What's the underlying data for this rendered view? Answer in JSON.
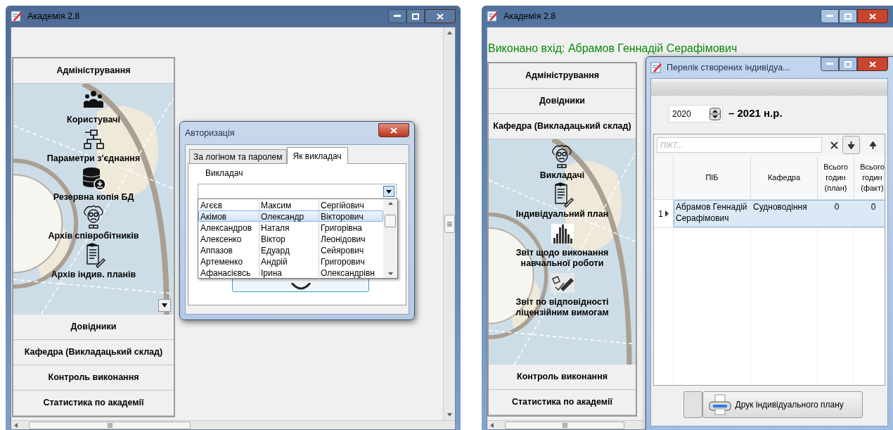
{
  "left_window": {
    "title": "Академія 2.8",
    "nav": [
      {
        "label": "Адміністрування",
        "items": [
          {
            "label": "Користувачі",
            "kind": "users"
          },
          {
            "label": "Параметри з'єднання",
            "kind": "network"
          },
          {
            "label": "Резервна копія БД",
            "kind": "database"
          },
          {
            "label": "Архів співробітників",
            "kind": "professor"
          },
          {
            "label": "Архів індив. планів",
            "kind": "document"
          }
        ]
      },
      {
        "label": "Довідники"
      },
      {
        "label": "Кафедра (Викладацький склад)"
      },
      {
        "label": "Контроль виконання"
      },
      {
        "label": "Статистика по академії"
      }
    ]
  },
  "auth_dialog": {
    "title": "Авторизація",
    "tabs": [
      {
        "label": "За логіном та паролем",
        "selected": false
      },
      {
        "label": "Як викладач",
        "selected": true
      }
    ],
    "field_label": "Викладач",
    "rows": [
      {
        "cells": [
          "Агєєв",
          "Максим",
          "Сергійович"
        ],
        "selected": false
      },
      {
        "cells": [
          "Акімов",
          "Олександр",
          "Вікторович"
        ],
        "selected": true
      },
      {
        "cells": [
          "Александров",
          "Наталя",
          "Григорівна"
        ],
        "selected": false
      },
      {
        "cells": [
          "Алексенко",
          "Віктор",
          "Леонідович"
        ],
        "selected": false
      },
      {
        "cells": [
          "Аппазов",
          "Едуард",
          "Сейярович"
        ],
        "selected": false
      },
      {
        "cells": [
          "Артеменко",
          "Андрій",
          "Григорович"
        ],
        "selected": false
      },
      {
        "cells": [
          "Афанасієвсь",
          "Ірина",
          "Олександрівн"
        ],
        "selected": false
      }
    ]
  },
  "right_window": {
    "title": "Академія 2.8",
    "status": "Виконано вхід: Абрамов Геннадій Серафімович",
    "nav": [
      {
        "label": "Адміністрування"
      },
      {
        "label": "Довідники"
      },
      {
        "label": "Кафедра (Викладацький склад)",
        "items": [
          {
            "label": "Викладачі",
            "kind": "professor"
          },
          {
            "label": "Індивідуальний план",
            "kind": "document"
          },
          {
            "label": "Звіт щодо виконання навчальної роботи",
            "kind": "chart"
          },
          {
            "label": "Звіт по відповідності ліцензійним вимогам",
            "kind": "pencil"
          }
        ]
      },
      {
        "label": "Контроль виконання"
      },
      {
        "label": "Статистика по академії"
      }
    ]
  },
  "plans_window": {
    "title": "Перелік створених індивідуа...",
    "year": "2020",
    "year_suffix": "– 2021 н.р.",
    "search": {
      "placeholder": "ПІКТ..."
    },
    "columns": [
      "ПІБ",
      "Кафедра",
      "Всього годин (план)",
      "Всього годин (факт)"
    ],
    "rows": [
      {
        "number": "1",
        "cells": [
          "Абрамов Геннадій Серафімович",
          "Судноводіння",
          "0",
          "0"
        ],
        "selected": true
      }
    ],
    "print_button": "Друк індивідуального плану"
  }
}
